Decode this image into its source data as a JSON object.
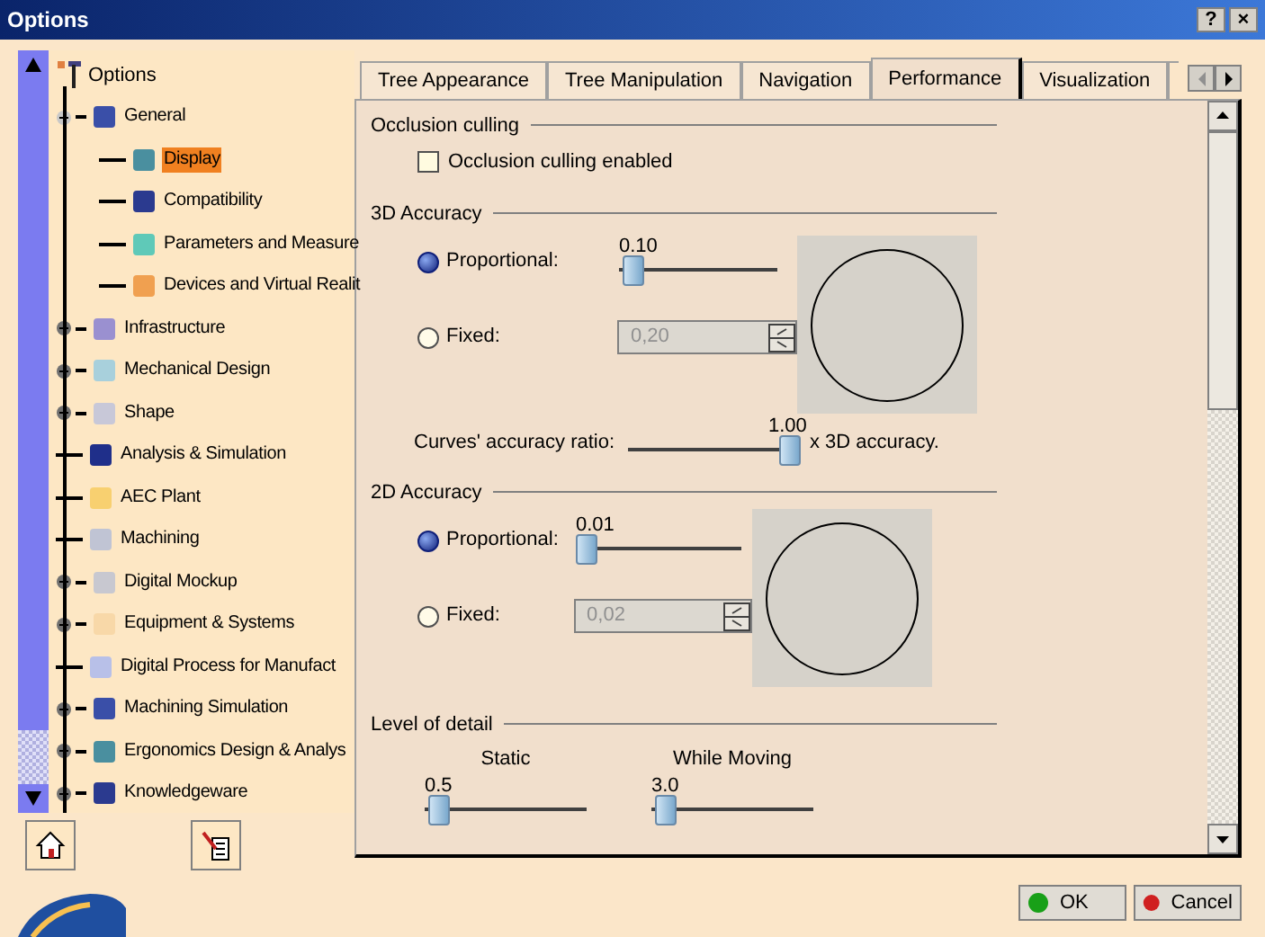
{
  "window": {
    "title": "Options",
    "controls": [
      "?",
      "×"
    ]
  },
  "tree": {
    "label": "Options",
    "children": [
      {
        "label": "General",
        "kind": "folder",
        "expanded": true,
        "selected": false,
        "children": [
          {
            "label": "Display",
            "kind": "leaf",
            "selected": true
          },
          {
            "label": "Compatibility",
            "kind": "leaf",
            "selected": false
          },
          {
            "label": "Parameters and Measure",
            "kind": "leaf",
            "selected": false
          },
          {
            "label": "Devices and Virtual Realit",
            "kind": "leaf",
            "selected": false
          }
        ]
      },
      {
        "label": "Infrastructure",
        "kind": "folder",
        "expanded": false,
        "selected": false
      },
      {
        "label": "Mechanical Design",
        "kind": "folder",
        "expanded": false,
        "selected": false
      },
      {
        "label": "Shape",
        "kind": "folder",
        "expanded": false,
        "selected": false
      },
      {
        "label": "Analysis & Simulation",
        "kind": "leaf",
        "selected": false
      },
      {
        "label": "AEC Plant",
        "kind": "leaf",
        "selected": false
      },
      {
        "label": "Machining",
        "kind": "leaf",
        "selected": false
      },
      {
        "label": "Digital Mockup",
        "kind": "folder",
        "expanded": false,
        "selected": false
      },
      {
        "label": "Equipment & Systems",
        "kind": "folder",
        "expanded": false,
        "selected": false
      },
      {
        "label": "Digital Process for Manufact",
        "kind": "leaf",
        "selected": false
      },
      {
        "label": "Machining Simulation",
        "kind": "folder",
        "expanded": false,
        "selected": false
      },
      {
        "label": "Ergonomics Design & Analys",
        "kind": "folder",
        "expanded": false,
        "selected": false
      },
      {
        "label": "Knowledgeware",
        "kind": "folder",
        "expanded": false,
        "selected": false
      }
    ]
  },
  "tabs": [
    {
      "label": "Tree Appearance",
      "selected": false
    },
    {
      "label": "Tree Manipulation",
      "selected": false
    },
    {
      "label": "Navigation",
      "selected": false
    },
    {
      "label": "Performance",
      "selected": true
    },
    {
      "label": "Visualization",
      "selected": false
    }
  ],
  "occlusion": {
    "title": "Occlusion culling",
    "checkbox": {
      "label": "Occlusion culling enabled",
      "checked": false
    }
  },
  "accuracy_3d": {
    "title": "3D Accuracy",
    "proportional": {
      "label": "Proportional:",
      "selected": true,
      "reading": "0.10",
      "level": 0.02
    },
    "fixed": {
      "label": "Fixed:",
      "selected": false,
      "value": "0,20"
    },
    "curves": {
      "label": "Curves' accuracy ratio:",
      "reading": "1.00",
      "level": 1,
      "suffix": "x 3D accuracy."
    }
  },
  "accuracy_2d": {
    "title": "2D Accuracy",
    "proportional": {
      "label": "Proportional:",
      "selected": true,
      "reading": "0.01",
      "level": 0
    },
    "fixed": {
      "label": "Fixed:",
      "selected": false,
      "value": "0,02"
    }
  },
  "level_of_detail": {
    "title": "Level of detail",
    "static": {
      "label": "Static",
      "reading": "0.5",
      "level": 0.02
    },
    "moving": {
      "label": "While Moving",
      "reading": "3.0",
      "level": 0.02
    }
  },
  "buttons": [
    {
      "label": "OK",
      "kind": "ok"
    },
    {
      "label": "Cancel",
      "kind": "cancel"
    }
  ]
}
